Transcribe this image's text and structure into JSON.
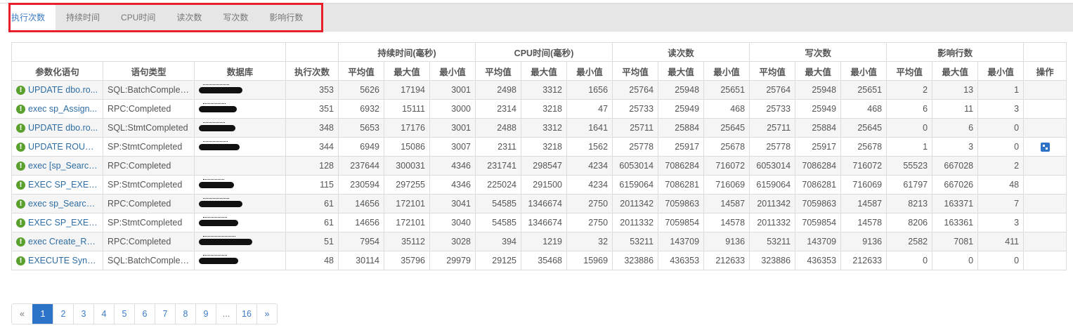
{
  "tabs": [
    {
      "label": "执行次数",
      "active": true
    },
    {
      "label": "持续时间",
      "active": false
    },
    {
      "label": "CPU时间",
      "active": false
    },
    {
      "label": "读次数",
      "active": false
    },
    {
      "label": "写次数",
      "active": false
    },
    {
      "label": "影响行数",
      "active": false
    }
  ],
  "table": {
    "group_headers": {
      "duration": "持续时间(毫秒)",
      "cpu": "CPU时间(毫秒)",
      "reads": "读次数",
      "writes": "写次数",
      "rows": "影响行数"
    },
    "headers": {
      "statement": "参数化语句",
      "type": "语句类型",
      "database": "数据库",
      "exec_count": "执行次数",
      "avg": "平均值",
      "max": "最大值",
      "min": "最小值",
      "action": "操作"
    },
    "rows": [
      {
        "statement": "UPDATE dbo.ro...",
        "type": "SQL:BatchComplet...",
        "db_redact": 62,
        "exec": "353",
        "dur": [
          "5626",
          "17194",
          "3001"
        ],
        "cpu": [
          "2498",
          "3312",
          "1656"
        ],
        "reads": [
          "25764",
          "25948",
          "25651"
        ],
        "writes": [
          "25764",
          "25948",
          "25651"
        ],
        "rows": [
          "2",
          "13",
          "1"
        ],
        "action": false
      },
      {
        "statement": "exec sp_Assign...",
        "type": "RPC:Completed",
        "db_redact": 54,
        "exec": "351",
        "dur": [
          "6932",
          "15111",
          "3000"
        ],
        "cpu": [
          "2314",
          "3218",
          "47"
        ],
        "reads": [
          "25733",
          "25949",
          "468"
        ],
        "writes": [
          "25733",
          "25949",
          "468"
        ],
        "rows": [
          "6",
          "11",
          "3"
        ],
        "action": false
      },
      {
        "statement": "UPDATE dbo.ro...",
        "type": "SQL:StmtCompleted",
        "db_redact": 52,
        "exec": "348",
        "dur": [
          "5653",
          "17176",
          "3001"
        ],
        "cpu": [
          "2488",
          "3312",
          "1641"
        ],
        "reads": [
          "25711",
          "25884",
          "25645"
        ],
        "writes": [
          "25711",
          "25884",
          "25645"
        ],
        "rows": [
          "0",
          "6",
          "0"
        ],
        "action": false
      },
      {
        "statement": "UPDATE ROUTE...",
        "type": "SP:StmtCompleted",
        "db_redact": 58,
        "exec": "344",
        "dur": [
          "6949",
          "15086",
          "3007"
        ],
        "cpu": [
          "2311",
          "3218",
          "1562"
        ],
        "reads": [
          "25778",
          "25917",
          "25678"
        ],
        "writes": [
          "25778",
          "25917",
          "25678"
        ],
        "rows": [
          "1",
          "3",
          "0"
        ],
        "action": true
      },
      {
        "statement": "exec [sp_Search...",
        "type": "RPC:Completed",
        "db_redact": 0,
        "exec": "128",
        "dur": [
          "237644",
          "300031",
          "4346"
        ],
        "cpu": [
          "231741",
          "298547",
          "4234"
        ],
        "reads": [
          "6053014",
          "7086284",
          "716072"
        ],
        "writes": [
          "6053014",
          "7086284",
          "716072"
        ],
        "rows": [
          "55523",
          "667028",
          "2"
        ],
        "action": false
      },
      {
        "statement": "EXEC SP_EXECU...",
        "type": "SP:StmtCompleted",
        "db_redact": 50,
        "exec": "115",
        "dur": [
          "230594",
          "297255",
          "4346"
        ],
        "cpu": [
          "225024",
          "291500",
          "4234"
        ],
        "reads": [
          "6159064",
          "7086281",
          "716069"
        ],
        "writes": [
          "6159064",
          "7086281",
          "716069"
        ],
        "rows": [
          "61797",
          "667026",
          "48"
        ],
        "action": false
      },
      {
        "statement": "exec sp_Search...",
        "type": "RPC:Completed",
        "db_redact": 62,
        "exec": "61",
        "dur": [
          "14656",
          "172101",
          "3041"
        ],
        "cpu": [
          "54585",
          "1346674",
          "2750"
        ],
        "reads": [
          "2011342",
          "7059863",
          "14587"
        ],
        "writes": [
          "2011342",
          "7059863",
          "14587"
        ],
        "rows": [
          "8213",
          "163371",
          "7"
        ],
        "action": false
      },
      {
        "statement": "EXEC SP_EXECU...",
        "type": "SP:StmtCompleted",
        "db_redact": 56,
        "exec": "61",
        "dur": [
          "14656",
          "172101",
          "3040"
        ],
        "cpu": [
          "54585",
          "1346674",
          "2750"
        ],
        "reads": [
          "2011332",
          "7059854",
          "14578"
        ],
        "writes": [
          "2011332",
          "7059854",
          "14578"
        ],
        "rows": [
          "8206",
          "163361",
          "3"
        ],
        "action": false
      },
      {
        "statement": "exec Create_Ro...",
        "type": "RPC:Completed",
        "db_redact": 76,
        "exec": "51",
        "dur": [
          "7954",
          "35112",
          "3028"
        ],
        "cpu": [
          "394",
          "1219",
          "32"
        ],
        "reads": [
          "53211",
          "143709",
          "9136"
        ],
        "writes": [
          "53211",
          "143709",
          "9136"
        ],
        "rows": [
          "2582",
          "7081",
          "411"
        ],
        "action": false
      },
      {
        "statement": "EXECUTE SyncD...",
        "type": "SQL:BatchComplet...",
        "db_redact": 56,
        "exec": "48",
        "dur": [
          "30114",
          "35796",
          "29979"
        ],
        "cpu": [
          "29125",
          "35468",
          "15969"
        ],
        "reads": [
          "323886",
          "436353",
          "212633"
        ],
        "writes": [
          "323886",
          "436353",
          "212633"
        ],
        "rows": [
          "0",
          "0",
          "0"
        ],
        "action": false
      }
    ]
  },
  "pagination": {
    "prev": "«",
    "next": "»",
    "pages": [
      "1",
      "2",
      "3",
      "4",
      "5",
      "6",
      "7",
      "8",
      "9",
      "...",
      "16"
    ],
    "active": "1"
  },
  "icons": {
    "info": "info-icon",
    "action": "detail-icon"
  },
  "colors": {
    "accent": "#2d73c8",
    "info_green": "#5aa02c",
    "highlight_box": "#e8202a",
    "tabbar_bg": "#e6e6e6"
  }
}
